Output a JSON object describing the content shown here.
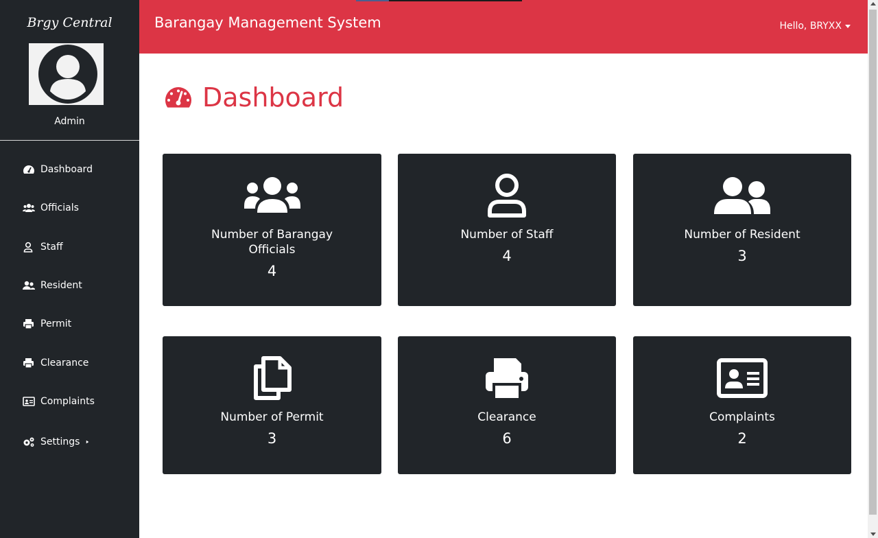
{
  "sidebar": {
    "brand": "Brgy Central",
    "role": "Admin",
    "items": [
      {
        "label": "Dashboard",
        "icon": "gauge-icon"
      },
      {
        "label": "Officials",
        "icon": "users-icon"
      },
      {
        "label": "Staff",
        "icon": "user-icon"
      },
      {
        "label": "Resident",
        "icon": "user-friends-icon"
      },
      {
        "label": "Permit",
        "icon": "print-icon"
      },
      {
        "label": "Clearance",
        "icon": "print-icon"
      },
      {
        "label": "Complaints",
        "icon": "id-card-icon"
      },
      {
        "label": "Settings",
        "icon": "cogs-icon"
      }
    ]
  },
  "header": {
    "title": "Barangay Management System",
    "greeting": "Hello, BRYXX"
  },
  "main": {
    "page_title": "Dashboard",
    "cards": [
      {
        "label": "Number of Barangay Officials",
        "value": "4",
        "icon": "users-icon"
      },
      {
        "label": "Number of Staff",
        "value": "4",
        "icon": "user-icon"
      },
      {
        "label": "Number of Resident",
        "value": "3",
        "icon": "user-friends-icon"
      },
      {
        "label": "Number of Permit",
        "value": "3",
        "icon": "copy-icon"
      },
      {
        "label": "Clearance",
        "value": "6",
        "icon": "print-icon"
      },
      {
        "label": "Complaints",
        "value": "2",
        "icon": "id-card-icon"
      }
    ]
  },
  "colors": {
    "accent": "#dc3545",
    "sidebar_bg": "#212529",
    "card_bg": "#212529"
  }
}
